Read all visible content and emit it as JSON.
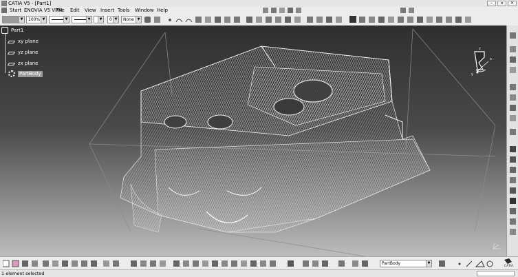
{
  "window": {
    "title": "CATIA V5 - [Part1]",
    "controls": [
      "–",
      "▫",
      "×"
    ]
  },
  "menu": [
    "Start",
    "ENOVIA V5 VPM",
    "File",
    "Edit",
    "View",
    "Insert",
    "Tools",
    "Window",
    "Help"
  ],
  "toolbar_top": {
    "zoom": "100%",
    "layer_value": "0",
    "render_style": "None"
  },
  "tree": {
    "root": "Part1",
    "items": [
      "xy plane",
      "yz plane",
      "zx plane"
    ],
    "body": "PartBody"
  },
  "toolbar_bottom": {
    "current_body": "PartBody"
  },
  "compass": {
    "x": "x",
    "y": "y",
    "z": "z"
  },
  "status": {
    "message": "1 element selected"
  },
  "brand": "CATIA",
  "colors": {
    "background_top": "#2f2f2f",
    "background_bottom": "#bdbdbd",
    "mesh": "#e9e9e9"
  }
}
